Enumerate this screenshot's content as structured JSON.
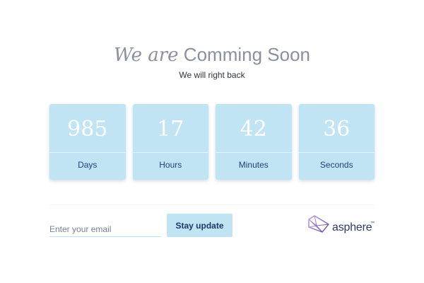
{
  "header": {
    "title_italic": "We are",
    "title_rest": "Comming Soon",
    "subtitle": "We will right back"
  },
  "countdown": [
    {
      "value": "985",
      "label": "Days"
    },
    {
      "value": "17",
      "label": "Hours"
    },
    {
      "value": "42",
      "label": "Minutes"
    },
    {
      "value": "36",
      "label": "Seconds"
    }
  ],
  "subscribe": {
    "email_placeholder": "Enter your email",
    "email_value": "",
    "button_label": "Stay update"
  },
  "brand": {
    "name": "asphere",
    "trademark": "™"
  },
  "colors": {
    "box_bg": "#c1e4f5",
    "title": "#8a90a0",
    "label": "#24407a",
    "logo_gradient_start": "#b89ad8",
    "logo_gradient_end": "#6e4aa8"
  }
}
